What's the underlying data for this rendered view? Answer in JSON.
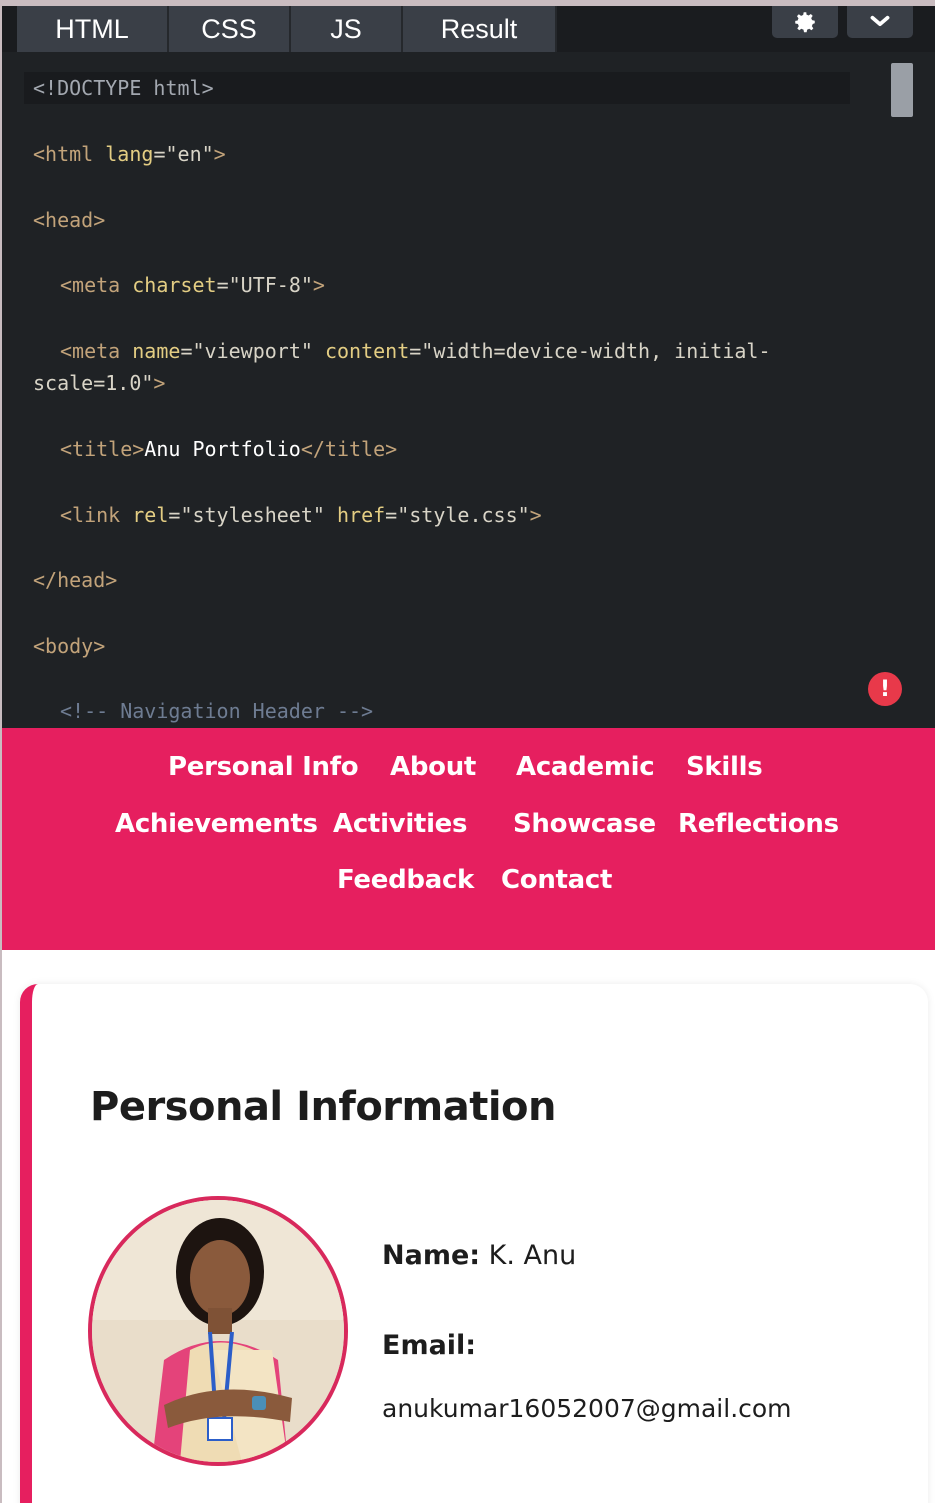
{
  "tabs": [
    {
      "label": "HTML"
    },
    {
      "label": "CSS"
    },
    {
      "label": "JS"
    },
    {
      "label": "Result"
    }
  ],
  "toolbar": {
    "settings_icon": "gear-icon",
    "collapse_icon": "chevron-down-icon"
  },
  "editor": {
    "lines": {
      "doctype": "<!DOCTYPE html>",
      "html_open_tag": "<html",
      "html_lang_attr": "lang",
      "html_lang_eq": "=",
      "html_lang_val": "\"en\"",
      "html_open_close": ">",
      "head_open": "<head>",
      "meta1_tag": "<meta",
      "meta1_attr": "charset",
      "meta1_val": "\"UTF-8\"",
      "meta2_tag": "<meta",
      "meta2_attr1": "name",
      "meta2_val1": "\"viewport\"",
      "meta2_attr2": "content",
      "meta2_val2a": "\"width=device-width, initial-",
      "meta2_val2b": "scale=1.0\"",
      "title_open": "<title>",
      "title_text": "Anu Portfolio",
      "title_close": "</title>",
      "link_tag": "<link",
      "link_attr1": "rel",
      "link_val1": "\"stylesheet\"",
      "link_attr2": "href",
      "link_val2": "\"style.css\"",
      "head_close": "</head>",
      "body_open": "<body>",
      "comment": "<!-- Navigation Header -->"
    },
    "error_symbol": "!"
  },
  "preview": {
    "accent_color": "#e61f5f",
    "nav": [
      {
        "label": "Personal Info"
      },
      {
        "label": "About"
      },
      {
        "label": "Academic"
      },
      {
        "label": "Skills"
      },
      {
        "label": "Achievements"
      },
      {
        "label": "Activities"
      },
      {
        "label": "Showcase"
      },
      {
        "label": "Reflections"
      },
      {
        "label": "Feedback"
      },
      {
        "label": "Contact"
      }
    ],
    "section_title": "Personal Information",
    "name_label": "Name:",
    "name_value": "K. Anu",
    "email_label": "Email:",
    "email_value": "anukumar16052007@gmail.com"
  }
}
